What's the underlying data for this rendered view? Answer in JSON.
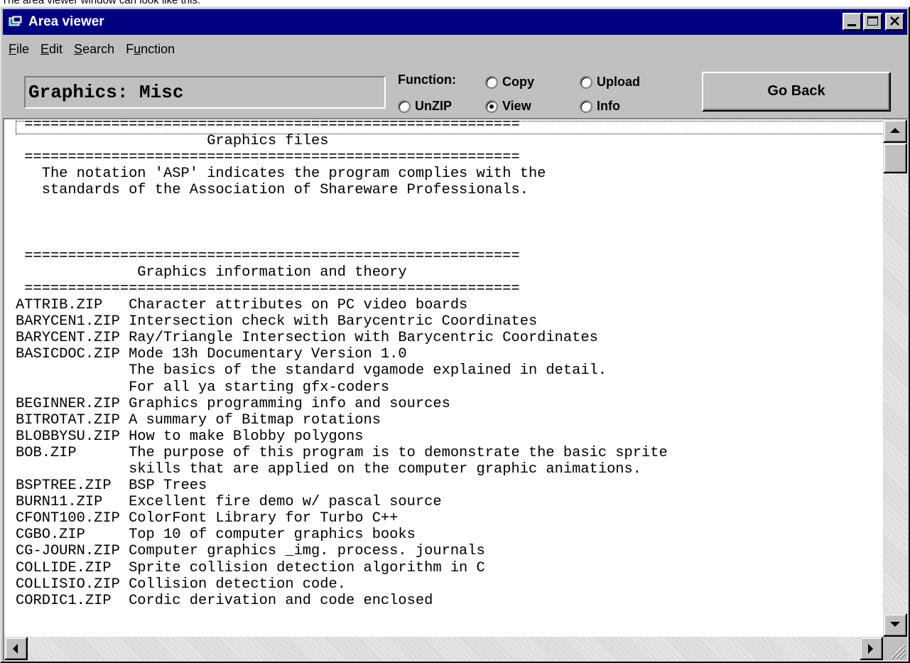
{
  "caption": "The area viewer window can look like this:",
  "window": {
    "title": "Area viewer"
  },
  "menu": {
    "items": [
      {
        "label": "File",
        "access": "F",
        "rest": "ile"
      },
      {
        "label": "Edit",
        "access": "E",
        "rest": "dit"
      },
      {
        "label": "Search",
        "access": "S",
        "rest": "earch"
      },
      {
        "label": "Function",
        "access": "u",
        "pre": "F",
        "rest": "nction"
      }
    ]
  },
  "area_name": "Graphics: Misc",
  "function": {
    "label": "Function:",
    "options": {
      "copy": "Copy",
      "upload": "Upload",
      "unzip": "UnZIP",
      "view": "View",
      "info": "Info"
    },
    "selected": "View"
  },
  "go_back_label": "Go Back",
  "content": {
    "lines": [
      " =========================================================",
      "                      Graphics files",
      " =========================================================",
      "   The notation 'ASP' indicates the program complies with the",
      "   standards of the Association of Shareware Professionals.",
      "",
      "",
      "",
      " =========================================================",
      "              Graphics information and theory",
      " =========================================================",
      "ATTRIB.ZIP   Character attributes on PC video boards",
      "BARYCEN1.ZIP Intersection check with Barycentric Coordinates",
      "BARYCENT.ZIP Ray/Triangle Intersection with Barycentric Coordinates",
      "BASICDOC.ZIP Mode 13h Documentary Version 1.0",
      "             The basics of the standard vgamode explained in detail.",
      "             For all ya starting gfx-coders",
      "BEGINNER.ZIP Graphics programming info and sources",
      "BITROTAT.ZIP A summary of Bitmap rotations",
      "BLOBBYSU.ZIP How to make Blobby polygons",
      "BOB.ZIP      The purpose of this program is to demonstrate the basic sprite",
      "             skills that are applied on the computer graphic animations.",
      "BSPTREE.ZIP  BSP Trees",
      "BURN11.ZIP   Excellent fire demo w/ pascal source",
      "CFONT100.ZIP ColorFont Library for Turbo C++",
      "CGBO.ZIP     Top 10 of computer graphics books",
      "CG-JOURN.ZIP Computer graphics _img. process. journals",
      "COLLIDE.ZIP  Sprite collision detection algorithm in C",
      "COLLISIO.ZIP Collision detection code.",
      "CORDIC1.ZIP  Cordic derivation and code enclosed"
    ]
  }
}
